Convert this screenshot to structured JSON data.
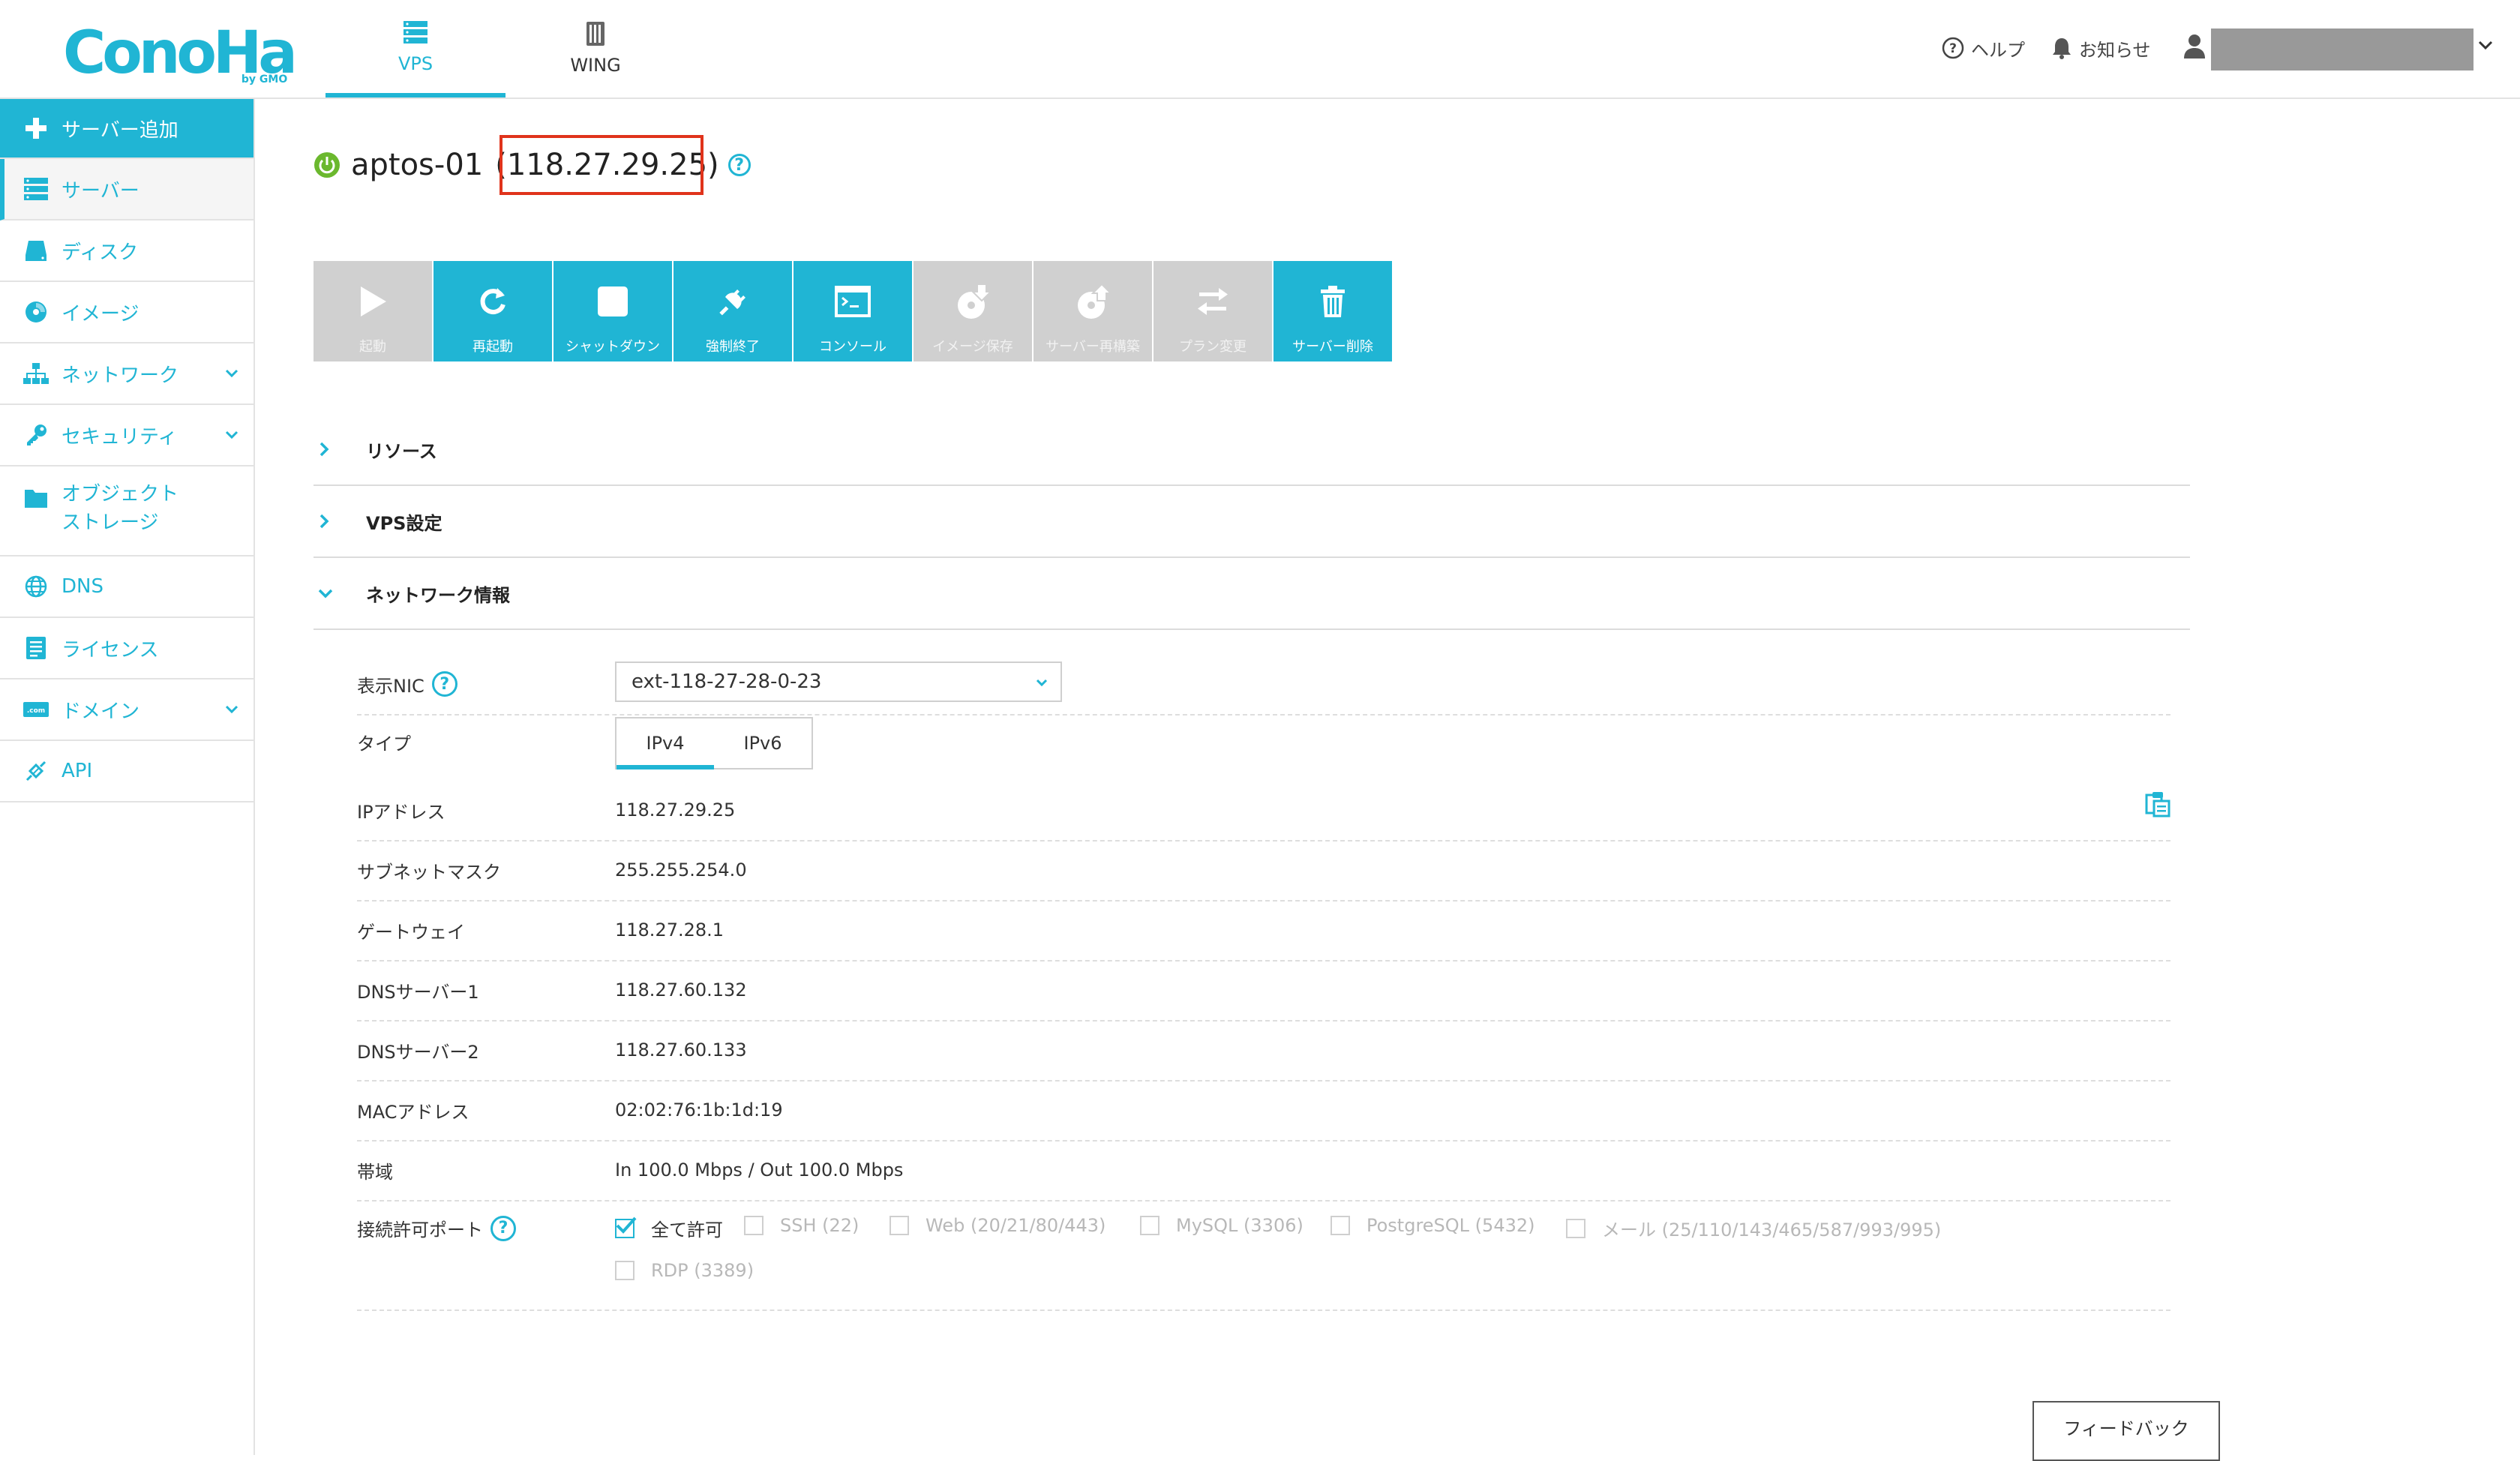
{
  "brand": {
    "logo_text": "ConoHa",
    "logo_sub": "by GMO",
    "accent_color": "#20b5d4",
    "alert_color": "#e0331b"
  },
  "top_tabs": [
    {
      "label": "VPS",
      "icon": "server-stack-icon",
      "active": true
    },
    {
      "label": "WING",
      "icon": "wing-server-icon",
      "active": false
    }
  ],
  "header_right": {
    "help": "ヘルプ",
    "notifications": "お知らせ",
    "user_icon": "user-icon"
  },
  "sidebar": {
    "items": [
      {
        "label": "サーバー追加",
        "icon": "plus-icon"
      },
      {
        "label": "サーバー",
        "icon": "server-icon"
      },
      {
        "label": "ディスク",
        "icon": "disk-icon"
      },
      {
        "label": "イメージ",
        "icon": "image-disc-icon"
      },
      {
        "label": "ネットワーク",
        "icon": "network-icon",
        "has_children": true
      },
      {
        "label": "セキュリティ",
        "icon": "key-icon",
        "has_children": true
      },
      {
        "label_line1": "オブジェクト",
        "label_line2": "ストレージ",
        "icon": "folder-icon"
      },
      {
        "label": "DNS",
        "icon": "globe-icon"
      },
      {
        "label": "ライセンス",
        "icon": "license-icon"
      },
      {
        "label": "ドメイン",
        "icon": "domain-icon",
        "has_children": true
      },
      {
        "label": "API",
        "icon": "api-icon"
      }
    ]
  },
  "server": {
    "status": "running",
    "name": "aptos-01",
    "ip_display": "(118.27.29.25)"
  },
  "toolbar": [
    {
      "label": "起動",
      "icon": "play-icon",
      "enabled": false
    },
    {
      "label": "再起動",
      "icon": "restart-icon",
      "enabled": true
    },
    {
      "label": "シャットダウン",
      "icon": "stop-icon",
      "enabled": true
    },
    {
      "label": "強制終了",
      "icon": "plug-icon",
      "enabled": true
    },
    {
      "label": "コンソール",
      "icon": "console-icon",
      "enabled": true
    },
    {
      "label": "イメージ保存",
      "icon": "image-save-icon",
      "enabled": false
    },
    {
      "label": "サーバー再構築",
      "icon": "rebuild-icon",
      "enabled": false
    },
    {
      "label": "プラン変更",
      "icon": "swap-icon",
      "enabled": false
    },
    {
      "label": "サーバー削除",
      "icon": "trash-icon",
      "enabled": true
    }
  ],
  "sections": [
    {
      "title": "リソース",
      "expanded": false
    },
    {
      "title": "VPS設定",
      "expanded": false
    },
    {
      "title": "ネットワーク情報",
      "expanded": true
    }
  ],
  "network": {
    "nic_label": "表示NIC",
    "nic_value": "ext-118-27-28-0-23",
    "type_label": "タイプ",
    "type_options": [
      "IPv4",
      "IPv6"
    ],
    "type_selected": "IPv4",
    "rows": [
      {
        "label": "IPアドレス",
        "value": "118.27.29.25"
      },
      {
        "label": "サブネットマスク",
        "value": "255.255.254.0"
      },
      {
        "label": "ゲートウェイ",
        "value": "118.27.28.1"
      },
      {
        "label": "DNSサーバー1",
        "value": "118.27.60.132"
      },
      {
        "label": "DNSサーバー2",
        "value": "118.27.60.133"
      },
      {
        "label": "MACアドレス",
        "value": "02:02:76:1b:1d:19"
      },
      {
        "label": "帯域",
        "value": "In 100.0 Mbps / Out 100.0 Mbps"
      }
    ],
    "ports_label": "接続許可ポート",
    "ports": [
      {
        "label": "全て許可",
        "checked": true
      },
      {
        "label": "SSH (22)",
        "checked": false
      },
      {
        "label": "Web (20/21/80/443)",
        "checked": false
      },
      {
        "label": "MySQL (3306)",
        "checked": false
      },
      {
        "label": "PostgreSQL (5432)",
        "checked": false
      },
      {
        "label": "メール (25/110/143/465/587/993/995)",
        "checked": false
      },
      {
        "label": "RDP (3389)",
        "checked": false
      }
    ]
  },
  "feedback": {
    "label": "フィードバック"
  }
}
